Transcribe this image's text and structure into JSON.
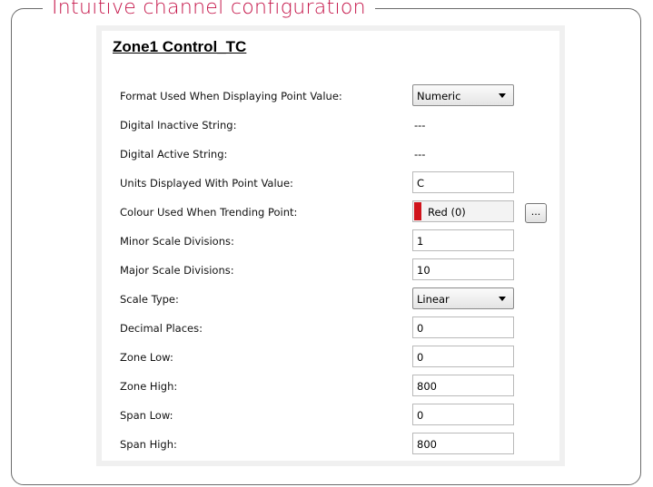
{
  "section_title": "Intuitive channel configuration",
  "panel": {
    "title": "Zone1 Control_TC",
    "rows": [
      {
        "label": "Format Used When Displaying Point Value:",
        "value": "Numeric",
        "kind": "select"
      },
      {
        "label": "Digital Inactive String:",
        "value": "---",
        "kind": "static"
      },
      {
        "label": "Digital Active String:",
        "value": "---",
        "kind": "static"
      },
      {
        "label": "Units Displayed With Point Value:",
        "value": "C",
        "kind": "input"
      },
      {
        "label": "Colour Used When Trending Point:",
        "value": "Red (0)",
        "kind": "colour",
        "swatch_color": "#d0141c",
        "button_label": "..."
      },
      {
        "label": "Minor Scale Divisions:",
        "value": "1",
        "kind": "input"
      },
      {
        "label": "Major Scale Divisions:",
        "value": "10",
        "kind": "input"
      },
      {
        "label": "Scale Type:",
        "value": "Linear",
        "kind": "select"
      },
      {
        "label": "Decimal Places:",
        "value": "0",
        "kind": "input"
      },
      {
        "label": "Zone Low:",
        "value": "0",
        "kind": "input"
      },
      {
        "label": "Zone High:",
        "value": "800",
        "kind": "input"
      },
      {
        "label": "Span Low:",
        "value": "0",
        "kind": "input"
      },
      {
        "label": "Span High:",
        "value": "800",
        "kind": "input"
      }
    ]
  },
  "colors": {
    "accent": "#c5164a",
    "trend_swatch": "#d0141c"
  },
  "icons": {
    "dropdown": "chevron-down-icon",
    "browse": "ellipsis-icon"
  }
}
